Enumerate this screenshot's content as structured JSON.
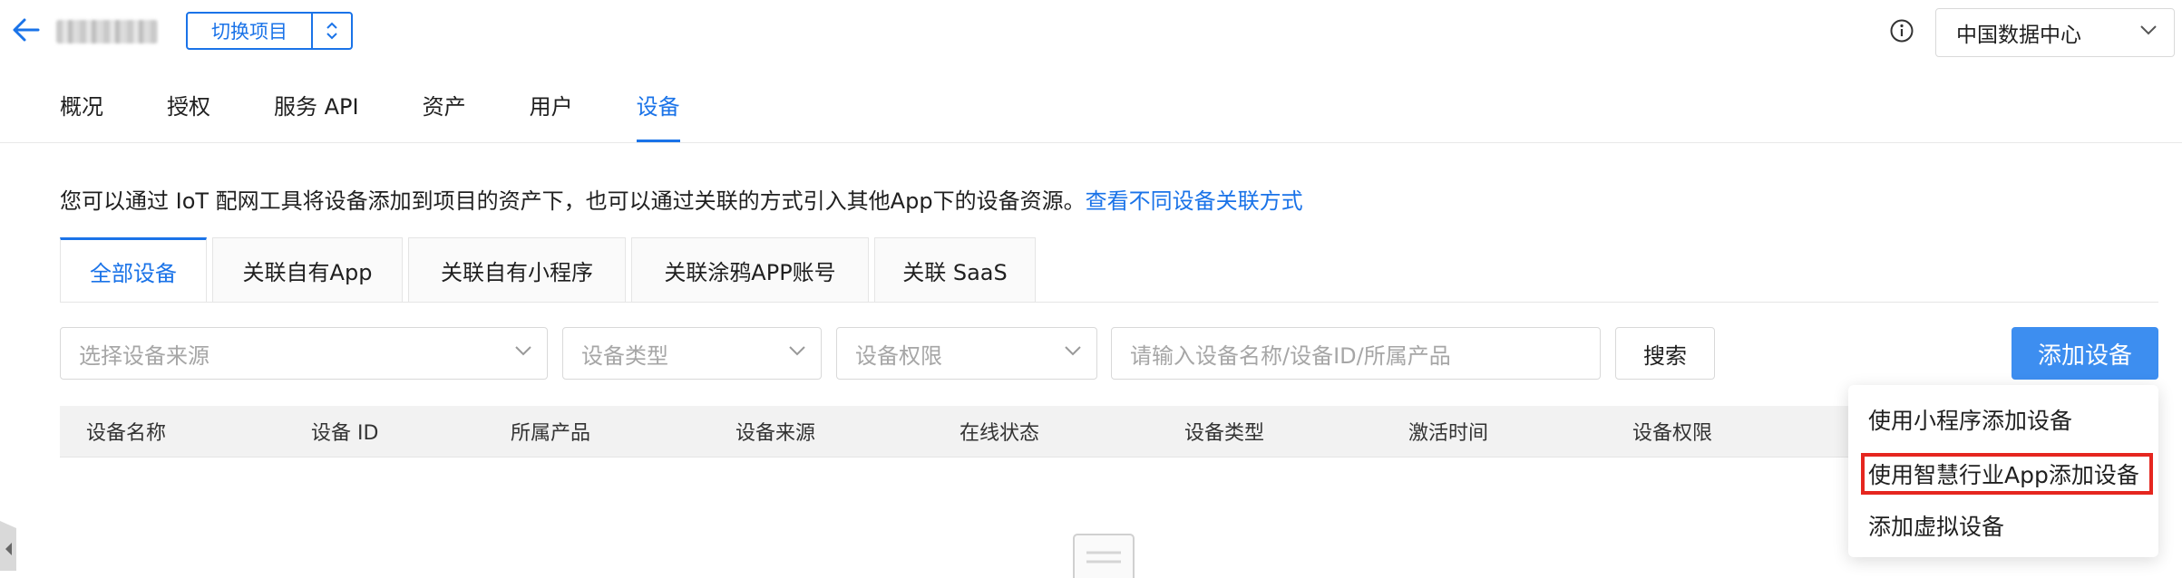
{
  "header": {
    "switch_label": "切换项目",
    "region": "中国数据中心"
  },
  "nav": {
    "items": [
      "概况",
      "授权",
      "服务 API",
      "资产",
      "用户",
      "设备"
    ]
  },
  "description": {
    "text": "您可以通过 IoT 配网工具将设备添加到项目的资产下，也可以通过关联的方式引入其他App下的设备资源。",
    "link": "查看不同设备关联方式"
  },
  "device_tabs": [
    "全部设备",
    "关联自有App",
    "关联自有小程序",
    "关联涂鸦APP账号",
    "关联 SaaS"
  ],
  "filters": {
    "source_placeholder": "选择设备来源",
    "type_placeholder": "设备类型",
    "permission_placeholder": "设备权限",
    "search_placeholder": "请输入设备名称/设备ID/所属产品",
    "search_button": "搜索",
    "add_button": "添加设备"
  },
  "table": {
    "columns": [
      "设备名称",
      "设备 ID",
      "所属产品",
      "设备来源",
      "在线状态",
      "设备类型",
      "激活时间",
      "设备权限"
    ]
  },
  "add_menu": {
    "items": [
      "使用小程序添加设备",
      "使用智慧行业App添加设备",
      "添加虚拟设备"
    ]
  },
  "colors": {
    "accent": "#1a73e8",
    "primary_button": "#3d8ef0",
    "highlight_border": "#e5261f"
  }
}
